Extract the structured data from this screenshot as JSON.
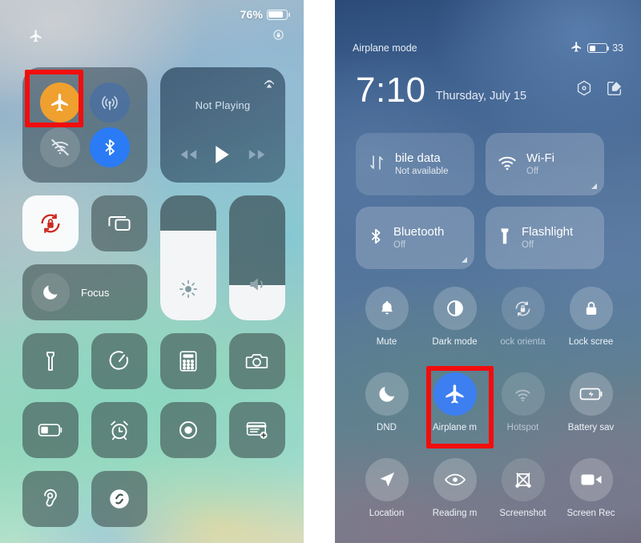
{
  "ios": {
    "status_bar": {
      "airplane_icon": "airplane-icon",
      "battery_percent": "76%",
      "battery_level": 76,
      "rotation_lock_icon": "rotation-lock-icon"
    },
    "connectivity": {
      "airplane": {
        "name": "airplane-mode",
        "state": "on",
        "color": "#f0a02e"
      },
      "cellular": {
        "name": "cellular-data",
        "state": "on",
        "color": "#466ea5"
      },
      "wifi": {
        "name": "wifi",
        "state": "off",
        "color": "#8e9ea8"
      },
      "bluetooth": {
        "name": "bluetooth",
        "state": "on",
        "color": "#2a7bf5"
      }
    },
    "media": {
      "title": "Not Playing",
      "airplay_icon": "airplay-icon",
      "prev_label": "rewind-icon",
      "play_label": "play-icon",
      "next_label": "fast-forward-icon"
    },
    "tiles": {
      "rotation_lock": {
        "label": "rotation-lock",
        "state": "on"
      },
      "screen_mirroring": {
        "label": "screen-mirroring",
        "state": "off"
      },
      "focus": {
        "label": "Focus",
        "state": "off"
      },
      "flashlight": {
        "label": "flashlight",
        "state": "off"
      },
      "timer": {
        "label": "timer",
        "state": "off"
      },
      "calculator": {
        "label": "calculator",
        "state": "off"
      },
      "camera": {
        "label": "camera",
        "state": "off"
      },
      "low_power": {
        "label": "low-power-mode",
        "state": "off"
      },
      "alarm": {
        "label": "alarm",
        "state": "off"
      },
      "voice_memos": {
        "label": "voice-memos",
        "state": "off"
      },
      "notes": {
        "label": "quick-note",
        "state": "off"
      },
      "hearing": {
        "label": "hearing",
        "state": "off"
      },
      "shazam": {
        "label": "shazam",
        "state": "off"
      }
    },
    "sliders": {
      "brightness": {
        "label": "brightness",
        "value": 72
      },
      "volume": {
        "label": "volume",
        "value": 28
      }
    },
    "highlight": {
      "target": "airplane-mode",
      "color": "#f20d0d"
    }
  },
  "miui": {
    "status_bar": {
      "left_text": "Airplane mode",
      "airplane_icon": "airplane-icon",
      "battery_percent": "33",
      "battery_level": 33
    },
    "header": {
      "time": "7:10",
      "date": "Thursday, July 15",
      "settings_icon": "settings-gear-icon",
      "edit_icon": "edit-pencil-icon"
    },
    "big_tiles": [
      {
        "title": "bile data",
        "subtitle": "Not available",
        "icon": "mobile-data-icon",
        "state": "off",
        "expandable": false
      },
      {
        "title": "Wi-Fi",
        "subtitle": "Off",
        "icon": "wifi-icon",
        "state": "off",
        "expandable": true
      },
      {
        "title": "Bluetooth",
        "subtitle": "Off",
        "icon": "bluetooth-icon",
        "state": "off",
        "expandable": true
      },
      {
        "title": "Flashlight",
        "subtitle": "Off",
        "icon": "flashlight-icon",
        "state": "off",
        "expandable": false
      }
    ],
    "toggles": [
      {
        "label": "Mute",
        "icon": "bell-icon",
        "state": "off"
      },
      {
        "label": "Dark mode",
        "icon": "dark-mode-icon",
        "state": "off"
      },
      {
        "label": "ock orienta",
        "icon": "rotation-lock-icon",
        "state": "disabled"
      },
      {
        "label": "Lock scree",
        "icon": "lock-icon",
        "state": "off"
      },
      {
        "label": "DND",
        "icon": "moon-icon",
        "state": "off"
      },
      {
        "label": "Airplane m",
        "icon": "airplane-icon",
        "state": "on"
      },
      {
        "label": "Hotspot",
        "icon": "hotspot-icon",
        "state": "disabled"
      },
      {
        "label": "Battery sav",
        "icon": "battery-saver-icon",
        "state": "off"
      },
      {
        "label": "Location",
        "icon": "location-arrow-icon",
        "state": "off"
      },
      {
        "label": "Reading m",
        "icon": "eye-icon",
        "state": "off"
      },
      {
        "label": "Screenshot",
        "icon": "screenshot-icon",
        "state": "off"
      },
      {
        "label": "Screen Rec",
        "icon": "video-camera-icon",
        "state": "off"
      }
    ],
    "highlight": {
      "target": "Airplane m",
      "color": "#f20d0d"
    },
    "accent_on_color": "#3d7ff0"
  }
}
